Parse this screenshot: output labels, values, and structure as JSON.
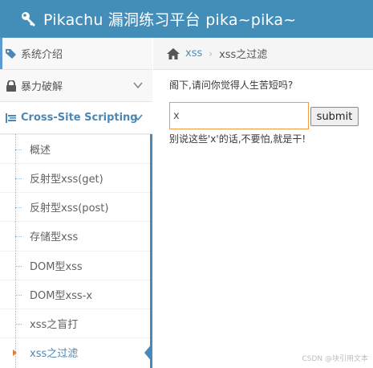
{
  "header": {
    "title": "Pikachu 漏洞练习平台 pika~pika~",
    "icon": "key-icon",
    "background_color": "#438eb9"
  },
  "sidebar": {
    "items": [
      {
        "label": "系统介绍",
        "icon": "tags-icon"
      },
      {
        "label": "暴力破解",
        "icon": "lock-icon",
        "expander": "chevron-down-icon"
      },
      {
        "label": "Cross-Site Scripting",
        "icon": "list-icon",
        "expander": "chevron-down-icon",
        "expanded": true
      }
    ],
    "xss_submenu": [
      {
        "label": "概述"
      },
      {
        "label": "反射型xss(get)"
      },
      {
        "label": "反射型xss(post)"
      },
      {
        "label": "存储型xss"
      },
      {
        "label": "DOM型xss"
      },
      {
        "label": "DOM型xss-x"
      },
      {
        "label": "xss之盲打"
      },
      {
        "label": "xss之过滤",
        "active": true
      }
    ],
    "accent_color": "#4b88b7"
  },
  "breadcrumb": {
    "icon": "home-icon",
    "link": "xss",
    "separator": "›",
    "current": "xss之过滤"
  },
  "main": {
    "question": "阁下,请问你觉得人生苦短吗?",
    "input_value": "x",
    "submit_label": "submit",
    "result_text": "别说这些'x'的话,不要怕,就是干!"
  },
  "watermark": "CSDN @块引用文本"
}
